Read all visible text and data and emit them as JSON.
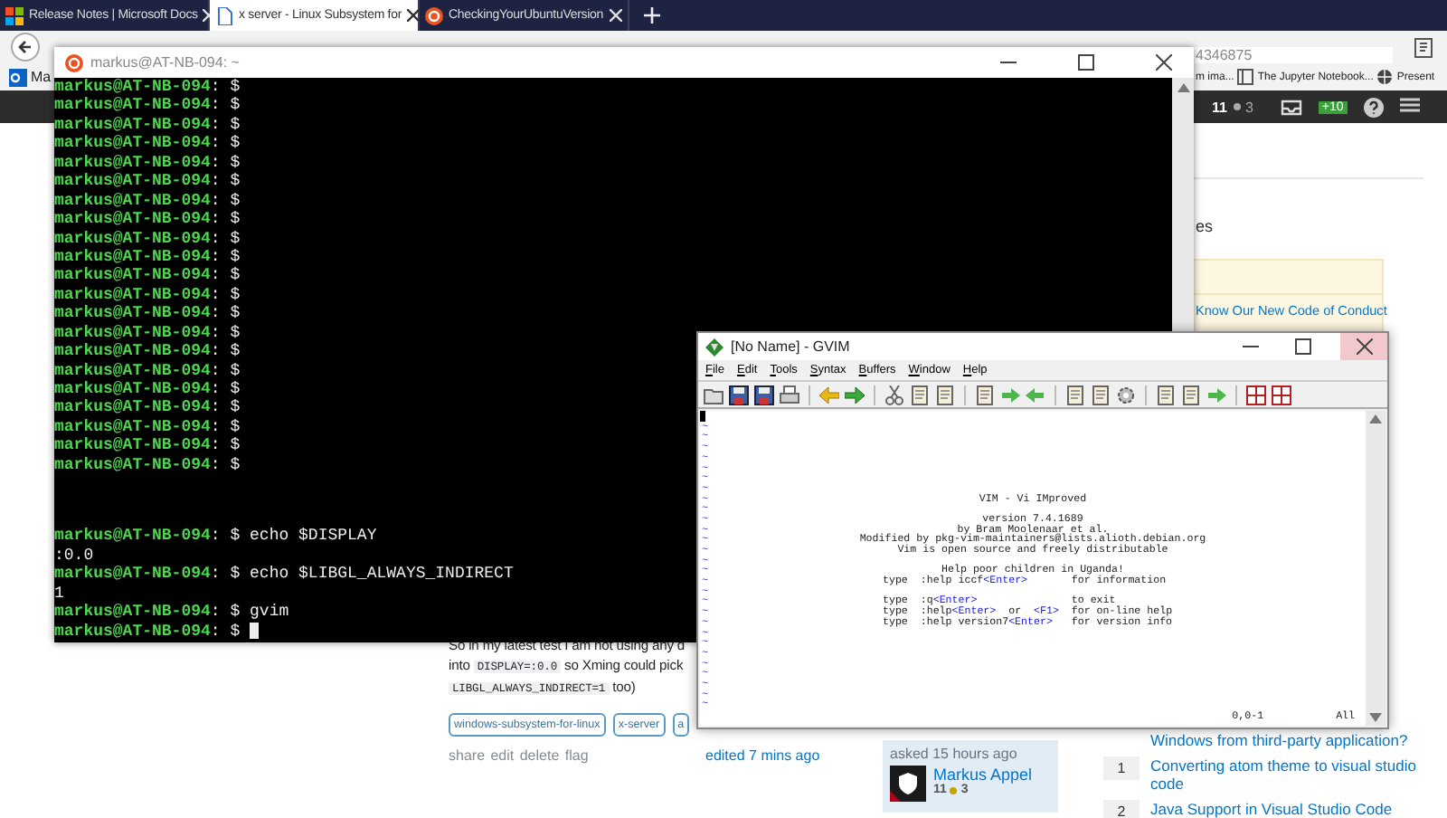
{
  "browser": {
    "tabs": [
      {
        "title": "Release Notes | Microsoft Docs",
        "selected": false
      },
      {
        "title": "x server - Linux Subsystem for",
        "selected": true
      },
      {
        "title": "CheckingYourUbuntuVersion",
        "selected": false
      }
    ],
    "url": "4346875",
    "bookmarks": [
      {
        "label": "Ma"
      },
      {
        "label": "m ima..."
      },
      {
        "label": "The Jupyter Notebook..."
      },
      {
        "label": "Present"
      }
    ]
  },
  "topbar": {
    "reputation": "11",
    "badges": "3",
    "inbox_count": "+10"
  },
  "page": {
    "sidebar_fragment": "es",
    "notice_link": "Know Our New Code of Conduct",
    "question_lines": [
      [
        {
          "text": "So in my latest test I am not using any d"
        }
      ],
      [
        {
          "text": "into "
        },
        {
          "code": "DISPLAY=:0.0"
        },
        {
          "text": " so Xming could pick"
        }
      ],
      [
        {
          "code": "LIBGL_ALWAYS_INDIRECT=1"
        },
        {
          "text": " too)"
        }
      ]
    ],
    "tags": [
      "windows-subsystem-for-linux",
      "x-server",
      "a"
    ],
    "post_menu": "share edit delete flag",
    "edited": "edited 7 mins ago",
    "asked": {
      "label": "asked 15 hours ago",
      "user": "Markus Appel",
      "reputation": "11",
      "badges": "3"
    },
    "related": [
      {
        "title": "Windows from third-party application?"
      },
      {
        "count": "1",
        "title": "Converting atom theme to visual studio code"
      },
      {
        "count": "2",
        "title": "Java Support in Visual Studio Code"
      }
    ]
  },
  "terminal": {
    "title": "markus@AT-NB-094: ~",
    "lines": [
      {
        "kind": "prompt",
        "user": "markus@AT-NB-094",
        "rest": ": $"
      },
      {
        "kind": "prompt",
        "user": "markus@AT-NB-094",
        "rest": ": $"
      },
      {
        "kind": "prompt",
        "user": "markus@AT-NB-094",
        "rest": ": $"
      },
      {
        "kind": "prompt",
        "user": "markus@AT-NB-094",
        "rest": ": $"
      },
      {
        "kind": "prompt",
        "user": "markus@AT-NB-094",
        "rest": ": $"
      },
      {
        "kind": "prompt",
        "user": "markus@AT-NB-094",
        "rest": ": $"
      },
      {
        "kind": "prompt",
        "user": "markus@AT-NB-094",
        "rest": ": $"
      },
      {
        "kind": "prompt",
        "user": "markus@AT-NB-094",
        "rest": ": $"
      },
      {
        "kind": "prompt",
        "user": "markus@AT-NB-094",
        "rest": ": $"
      },
      {
        "kind": "prompt",
        "user": "markus@AT-NB-094",
        "rest": ": $"
      },
      {
        "kind": "prompt",
        "user": "markus@AT-NB-094",
        "rest": ": $"
      },
      {
        "kind": "prompt",
        "user": "markus@AT-NB-094",
        "rest": ": $"
      },
      {
        "kind": "prompt",
        "user": "markus@AT-NB-094",
        "rest": ": $"
      },
      {
        "kind": "prompt",
        "user": "markus@AT-NB-094",
        "rest": ": $"
      },
      {
        "kind": "prompt",
        "user": "markus@AT-NB-094",
        "rest": ": $"
      },
      {
        "kind": "prompt",
        "user": "markus@AT-NB-094",
        "rest": ": $"
      },
      {
        "kind": "prompt",
        "user": "markus@AT-NB-094",
        "rest": ": $"
      },
      {
        "kind": "prompt",
        "user": "markus@AT-NB-094",
        "rest": ": $"
      },
      {
        "kind": "prompt",
        "user": "markus@AT-NB-094",
        "rest": ": $"
      },
      {
        "kind": "prompt",
        "user": "markus@AT-NB-094",
        "rest": ": $"
      },
      {
        "kind": "prompt",
        "user": "markus@AT-NB-094",
        "rest": ": $"
      },
      {
        "kind": "prompt",
        "user": "markus@AT-NB-094",
        "rest": ": $ echo $DISPLAY",
        "gap_before": true
      },
      {
        "kind": "output",
        "text": ":0.0"
      },
      {
        "kind": "prompt",
        "user": "markus@AT-NB-094",
        "rest": ": $ echo $LIBGL_ALWAYS_INDIRECT"
      },
      {
        "kind": "output",
        "text": "1"
      },
      {
        "kind": "prompt",
        "user": "markus@AT-NB-094",
        "rest": ": $ gvim"
      },
      {
        "kind": "prompt",
        "user": "markus@AT-NB-094",
        "rest": ": $",
        "cursor": true
      }
    ]
  },
  "gvim": {
    "title": "[No Name] - GVIM",
    "menu": [
      "File",
      "Edit",
      "Tools",
      "Syntax",
      "Buffers",
      "Window",
      "Help"
    ],
    "rows": [
      {
        "cursor": true
      },
      {
        "marker": "~"
      },
      {
        "marker": "~"
      },
      {
        "marker": "~"
      },
      {
        "marker": "~"
      },
      {
        "marker": "~"
      },
      {
        "marker": "~"
      },
      {
        "marker": "~"
      },
      {
        "marker": "~",
        "kind": "center",
        "parts": [
          {
            "text": "VIM - Vi IMproved"
          }
        ]
      },
      {
        "marker": "~"
      },
      {
        "marker": "~",
        "kind": "center",
        "parts": [
          {
            "text": "version 7.4.1689"
          }
        ]
      },
      {
        "marker": "~",
        "kind": "center",
        "parts": [
          {
            "text": "by Bram Moolenaar et al."
          }
        ]
      },
      {
        "marker": "~",
        "kind": "center",
        "parts": [
          {
            "text": "Modified by pkg-vim-maintainers@lists.alioth.debian.org"
          }
        ]
      },
      {
        "marker": "~",
        "kind": "center",
        "parts": [
          {
            "text": "Vim is open source and freely distributable"
          }
        ]
      },
      {
        "marker": "~"
      },
      {
        "marker": "~",
        "kind": "center",
        "parts": [
          {
            "text": "Help poor children in Uganda!"
          }
        ]
      },
      {
        "marker": "~",
        "kind": "help",
        "parts": [
          {
            "text": "type  :help iccf"
          },
          {
            "key": "<Enter>"
          },
          {
            "text": "       for information"
          }
        ]
      },
      {
        "marker": "~"
      },
      {
        "marker": "~",
        "kind": "help",
        "parts": [
          {
            "text": "type  :q"
          },
          {
            "key": "<Enter>"
          },
          {
            "text": "               to exit"
          }
        ]
      },
      {
        "marker": "~",
        "kind": "help",
        "parts": [
          {
            "text": "type  :help"
          },
          {
            "key": "<Enter>"
          },
          {
            "text": "  or  "
          },
          {
            "key": "<F1>"
          },
          {
            "text": "  for on-line help"
          }
        ]
      },
      {
        "marker": "~",
        "kind": "help",
        "parts": [
          {
            "text": "type  :help version7"
          },
          {
            "key": "<Enter>"
          },
          {
            "text": "   for version info"
          }
        ]
      },
      {
        "marker": "~"
      },
      {
        "marker": "~"
      },
      {
        "marker": "~"
      },
      {
        "marker": "~"
      },
      {
        "marker": "~"
      },
      {
        "marker": "~"
      },
      {
        "marker": "~"
      },
      {
        "marker": "~"
      }
    ],
    "position": "0,0-1",
    "scroll": "All"
  }
}
